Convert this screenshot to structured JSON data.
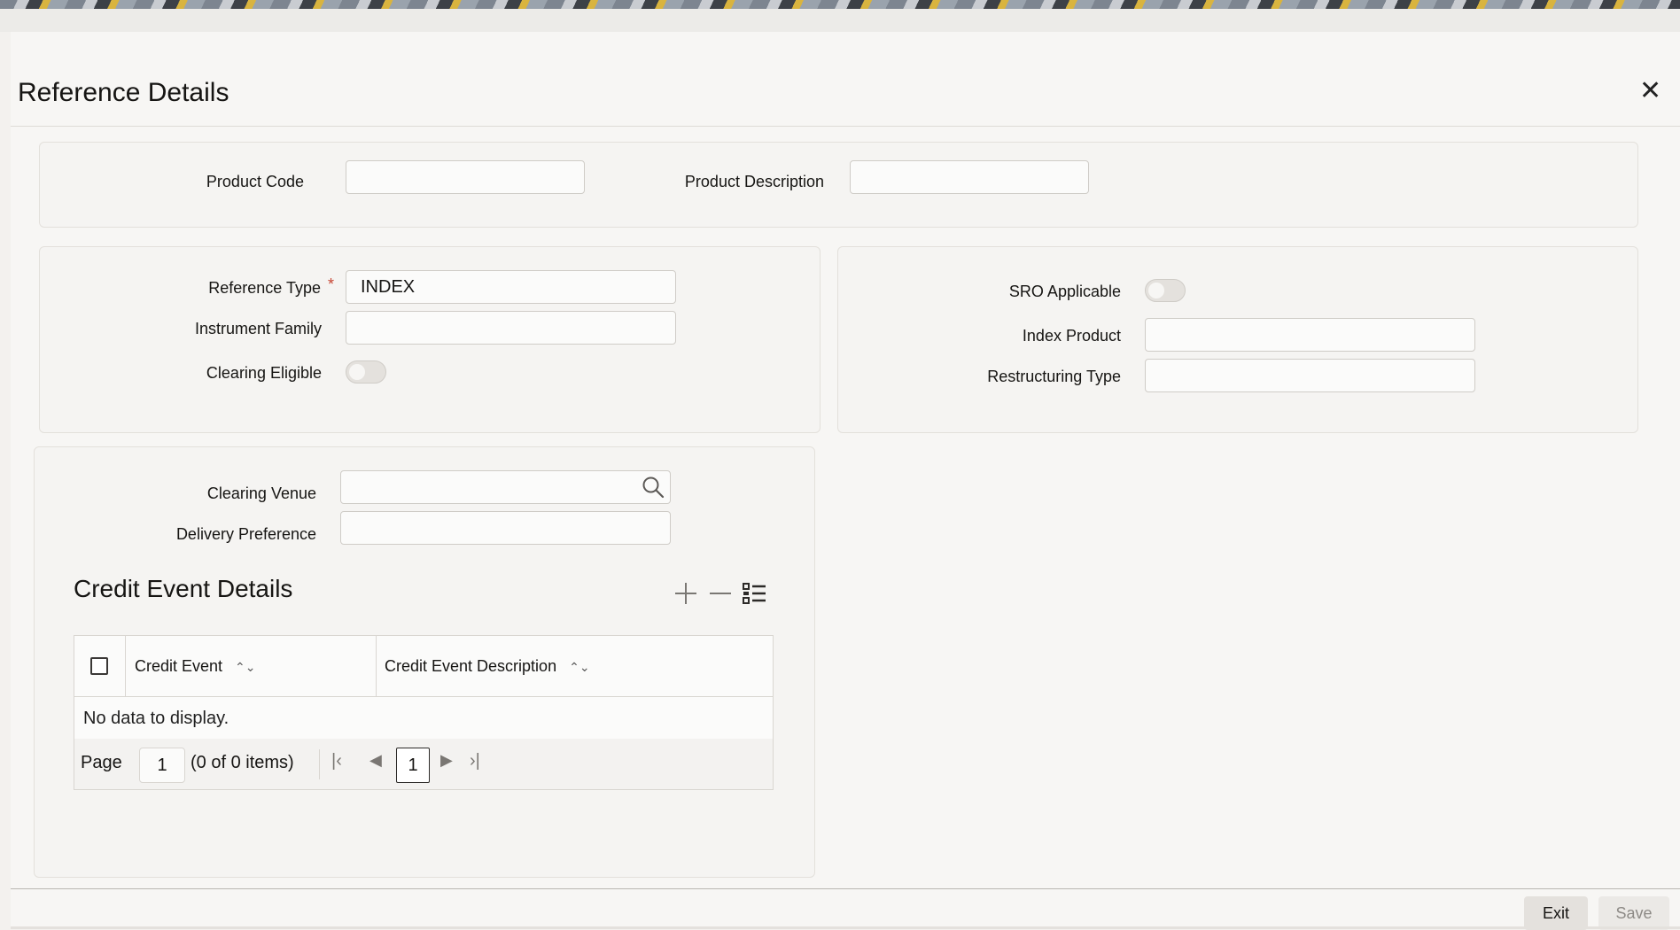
{
  "window": {
    "title": "Reference Details"
  },
  "product": {
    "code_label": "Product Code",
    "code_value": "",
    "desc_label": "Product Description",
    "desc_value": ""
  },
  "reference": {
    "type_label": "Reference Type",
    "type_required": "*",
    "type_value": "INDEX",
    "family_label": "Instrument Family",
    "family_value": "",
    "clearing_eligible_label": "Clearing Eligible",
    "clearing_eligible_on": false
  },
  "sro": {
    "applicable_label": "SRO Applicable",
    "applicable_on": false,
    "index_product_label": "Index Product",
    "index_product_value": "",
    "restructuring_label": "Restructuring Type",
    "restructuring_value": ""
  },
  "clearing": {
    "venue_label": "Clearing Venue",
    "venue_value": "",
    "delivery_label": "Delivery Preference",
    "delivery_value": ""
  },
  "credit_events": {
    "title": "Credit Event Details",
    "columns": [
      "Credit Event",
      "Credit Event Description"
    ],
    "empty_text": "No data to display.",
    "page_label": "Page",
    "page_value": "1",
    "items_text": "(0 of 0 items)",
    "current_page": "1"
  },
  "buttons": {
    "exit": "Exit",
    "save": "Save"
  },
  "colors": {
    "required": "#c74634",
    "button_bg": "#e4e1dd",
    "disabled_text": "#8d8a86"
  }
}
